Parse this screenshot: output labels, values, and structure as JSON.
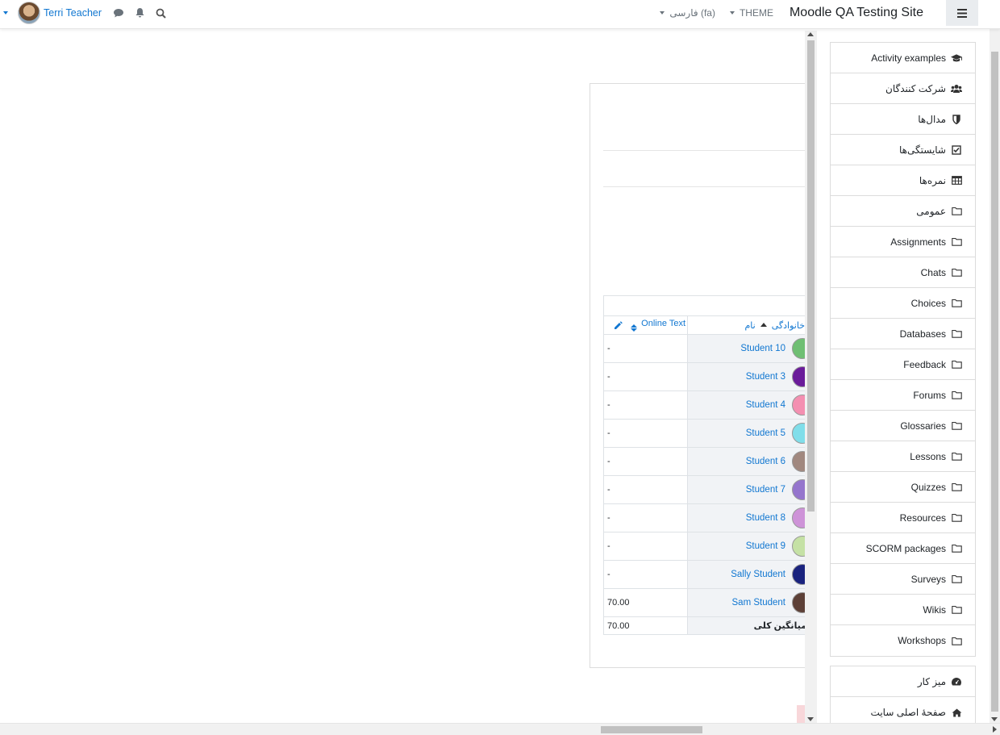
{
  "navbar": {
    "user_name": "Terri Teacher",
    "language_menu": "فارسی (fa)",
    "theme_menu": "THEME",
    "site_name": "Moodle QA Testing Site"
  },
  "grader": {
    "col_online_text": "Online Text",
    "col_name": "نام",
    "col_lastname": "خانوادگی",
    "rows": [
      {
        "name": "Student 10",
        "value": "-",
        "color": "#6fbf73"
      },
      {
        "name": "Student 3",
        "value": "-",
        "color": "#6a1b9a"
      },
      {
        "name": "Student 4",
        "value": "-",
        "color": "#f48fb1"
      },
      {
        "name": "Student 5",
        "value": "-",
        "color": "#80deea"
      },
      {
        "name": "Student 6",
        "value": "-",
        "color": "#a1887f"
      },
      {
        "name": "Student 7",
        "value": "-",
        "color": "#9575cd"
      },
      {
        "name": "Student 8",
        "value": "-",
        "color": "#ce93d8"
      },
      {
        "name": "Student 9",
        "value": "-",
        "color": "#c5e1a5"
      },
      {
        "name": "Sally Student",
        "value": "-",
        "color": "#1a237e"
      },
      {
        "name": "Sam Student",
        "value": "70.00",
        "color": "#5d4037"
      }
    ],
    "average_label": "میانگین کلی",
    "average_value": "70.00"
  },
  "drawer": {
    "items": [
      {
        "label": "Activity examples",
        "icon": "graduation-cap-icon"
      },
      {
        "label": "شرکت کنندگان",
        "icon": "users-icon"
      },
      {
        "label": "مدال‌ها",
        "icon": "shield-icon"
      },
      {
        "label": "شایستگی‌ها",
        "icon": "check-square-icon"
      },
      {
        "label": "نمره‌ها",
        "icon": "table-icon"
      },
      {
        "label": "عمومی",
        "icon": "folder-icon"
      },
      {
        "label": "Assignments",
        "icon": "folder-icon"
      },
      {
        "label": "Chats",
        "icon": "folder-icon"
      },
      {
        "label": "Choices",
        "icon": "folder-icon"
      },
      {
        "label": "Databases",
        "icon": "folder-icon"
      },
      {
        "label": "Feedback",
        "icon": "folder-icon"
      },
      {
        "label": "Forums",
        "icon": "folder-icon"
      },
      {
        "label": "Glossaries",
        "icon": "folder-icon"
      },
      {
        "label": "Lessons",
        "icon": "folder-icon"
      },
      {
        "label": "Quizzes",
        "icon": "folder-icon"
      },
      {
        "label": "Resources",
        "icon": "folder-icon"
      },
      {
        "label": "SCORM packages",
        "icon": "folder-icon"
      },
      {
        "label": "Surveys",
        "icon": "folder-icon"
      },
      {
        "label": "Wikis",
        "icon": "folder-icon"
      },
      {
        "label": "Workshops",
        "icon": "folder-icon"
      }
    ],
    "items2": [
      {
        "label": "میز کار",
        "icon": "dashboard-icon"
      },
      {
        "label": "صفحهٔ اصلی سایت",
        "icon": "home-icon"
      }
    ]
  },
  "colors": {
    "link": "#1177d1",
    "header_bg": "#ffffff",
    "cell_shade": "#f1f3f6"
  }
}
